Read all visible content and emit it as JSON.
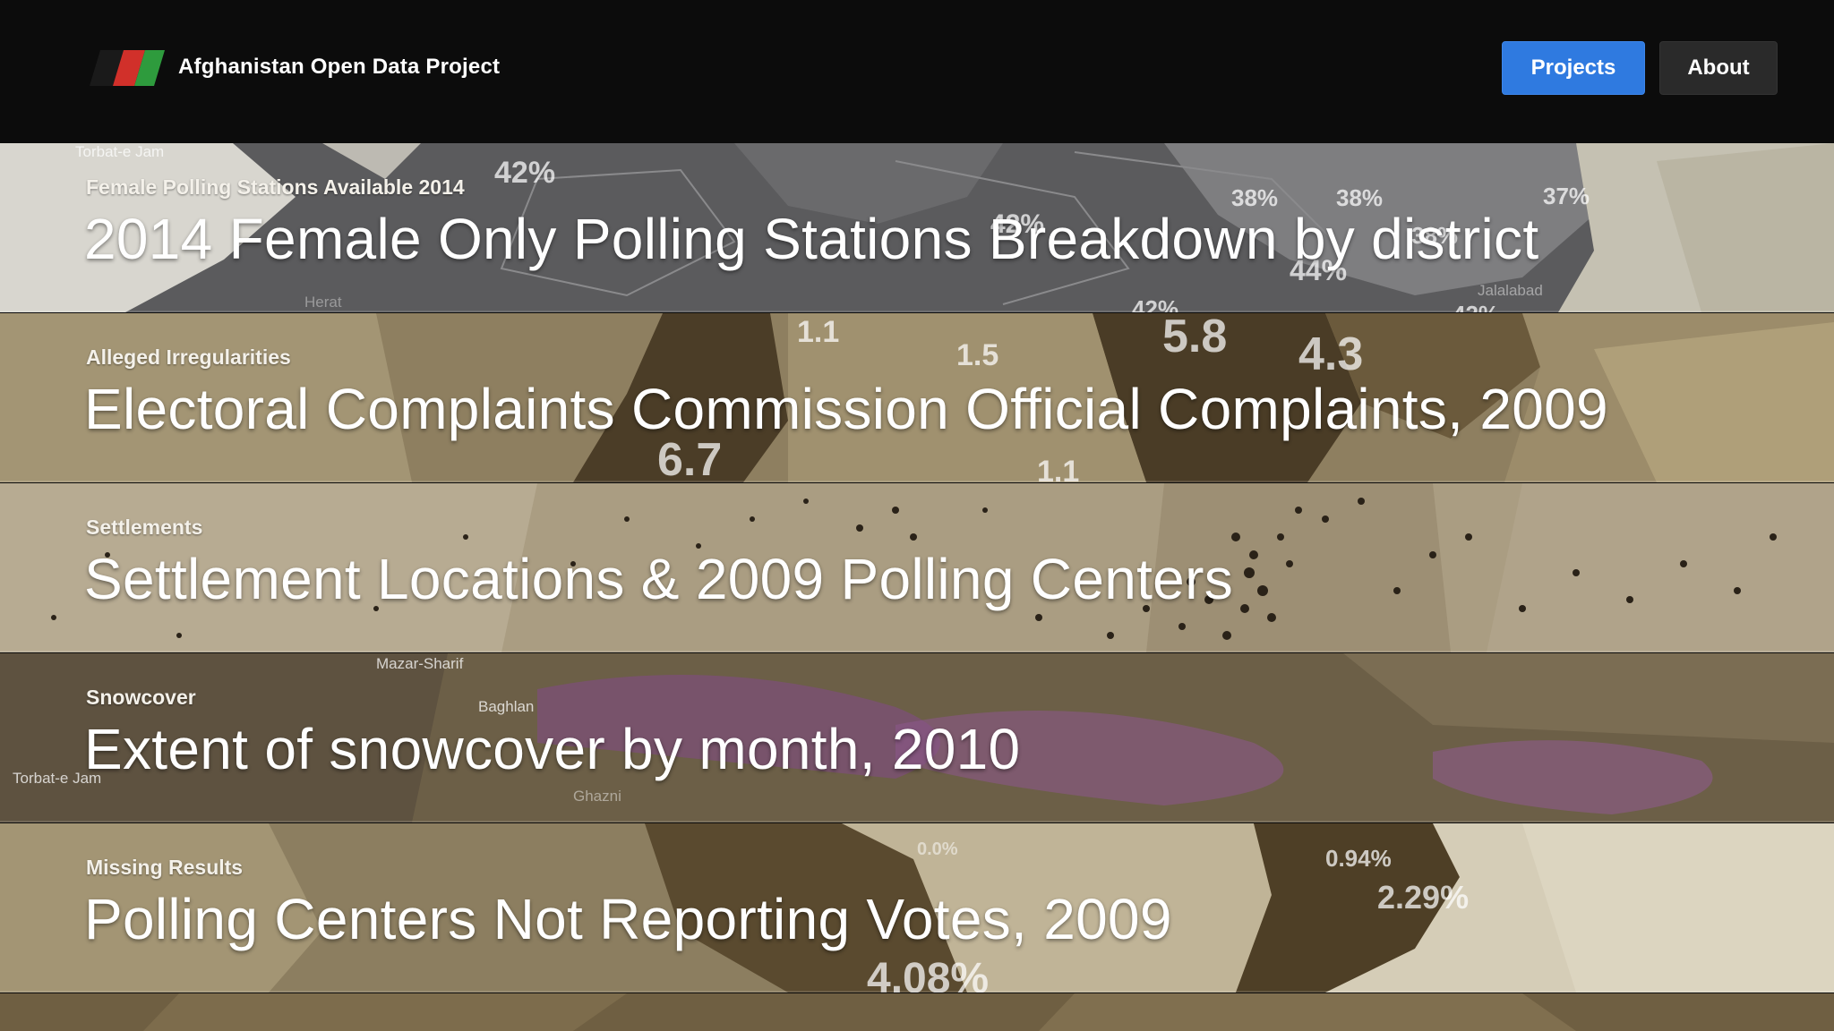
{
  "header": {
    "site_title": "Afghanistan Open Data Project",
    "nav": {
      "projects": "Projects",
      "about": "About"
    }
  },
  "colors": {
    "projects_button": "#2f7ae0",
    "about_button": "#2a2a2a",
    "header_bg": "#0c0c0c"
  },
  "projects": [
    {
      "category": "Female Polling Stations Available 2014",
      "title": "2014 Female Only Polling Stations  Breakdown by district",
      "map_labels": [
        "42%",
        "38%",
        "38%",
        "37%",
        "42%",
        "44%",
        "38%",
        "42%",
        "42%"
      ],
      "place_labels": [
        "Torbat-e Jam",
        "Herat",
        "Jalalabad"
      ]
    },
    {
      "category": "Alleged Irregularities",
      "title": "Electoral Complaints Commission Official Complaints, 2009",
      "map_labels": [
        "1.1",
        "1.5",
        "5.8",
        "4.3",
        "6.7",
        "1.1"
      ]
    },
    {
      "category": "Settlements",
      "title": "Settlement Locations & 2009 Polling Centers"
    },
    {
      "category": "Snowcover",
      "title": "Extent of snowcover by month, 2010",
      "place_labels": [
        "Mazar-Sharif",
        "Baghlan",
        "Torbat-e Jam",
        "Ghazni"
      ]
    },
    {
      "category": "Missing Results",
      "title": "Polling Centers Not Reporting Votes, 2009",
      "map_labels": [
        "0.0%",
        "0.94%",
        "2.29%",
        "4.08%"
      ]
    }
  ]
}
